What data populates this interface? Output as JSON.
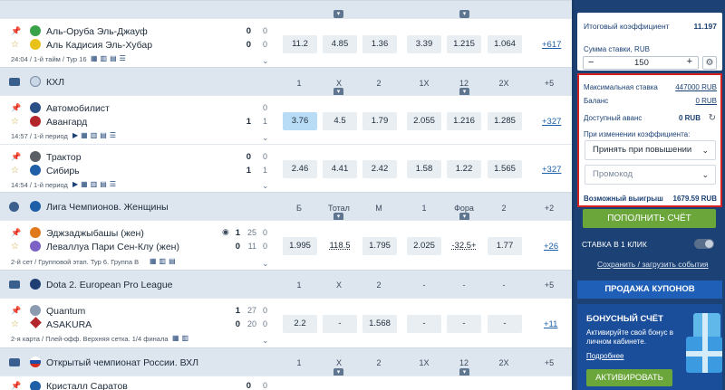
{
  "leagues": [
    {
      "name": "КХЛ",
      "cols": [
        "1",
        "X",
        "2",
        "1X",
        "12",
        "2X",
        "+5"
      ]
    },
    {
      "name": "Лига Чемпионов. Женщины",
      "cols": [
        "Б",
        "Тотал",
        "М",
        "1",
        "Фора",
        "2",
        "+2"
      ]
    },
    {
      "name": "Dota 2. European Pro League",
      "cols": [
        "1",
        "X",
        "2",
        "-",
        "-",
        "-",
        "+5"
      ]
    },
    {
      "name": "Открытый чемпионат России. ВХЛ",
      "cols": [
        "1",
        "X",
        "2",
        "1X",
        "12",
        "2X",
        "+5"
      ]
    }
  ],
  "matches": [
    {
      "team1": "Аль-Оруба Эль-Джауф",
      "team2": "Аль Кадисия Эль-Хубар",
      "s1": "0",
      "s2": "0",
      "p1": "0",
      "p2": "0",
      "info": "24:04 / 1-й тайм / Тур 16",
      "odds": [
        "11.2",
        "4.85",
        "1.36",
        "3.39",
        "1.215",
        "1.064"
      ],
      "more": "+617"
    },
    {
      "team1": "Автомобилист",
      "team2": "Авангард",
      "s1": "",
      "s2": "1",
      "p1": "0",
      "p2": "1",
      "info": "14:57 / 1-й период",
      "odds": [
        "3.76",
        "4.5",
        "1.79",
        "2.055",
        "1.216",
        "1.285"
      ],
      "more": "+327"
    },
    {
      "team1": "Трактор",
      "team2": "Сибирь",
      "s1": "0",
      "s2": "1",
      "p1": "0",
      "p2": "1",
      "info": "14:54 / 1-й период",
      "odds": [
        "2.46",
        "4.41",
        "2.42",
        "1.58",
        "1.22",
        "1.565"
      ],
      "more": "+327"
    },
    {
      "team1": "Эджзаджыбашы (жен)",
      "team2": "Леваллуа Пари Сен-Клу (жен)",
      "s1": "1",
      "s2": "0",
      "p1": "25",
      "p2": "11",
      "p1b": "0",
      "p2b": "0",
      "info": "2-й сет / Групповой этап. Тур 6. Группа B",
      "odds": [
        "1.995",
        "118.5",
        "1.795",
        "2.025",
        "-32.5+",
        "1.77"
      ],
      "more": "+26"
    },
    {
      "team1": "Quantum",
      "team2": "ASAKURA",
      "s1": "1",
      "s2": "0",
      "p1": "27",
      "p2": "20",
      "p1b": "0",
      "p2b": "0",
      "info": "2-я карта / Плей-офф. Верхняя сетка. 1/4 финала",
      "odds": [
        "2.2",
        "-",
        "1.568",
        "-",
        "-",
        "-"
      ],
      "more": "+11"
    },
    {
      "team1": "Кристалл Саратов",
      "s1": "0",
      "p1": "0"
    }
  ],
  "coupon": {
    "total_coef_label": "Итоговый коэффициент",
    "total_coef": "11.197",
    "stake_label": "Сумма ставки, RUB",
    "stake": "150",
    "minus": "−",
    "plus": "+",
    "max_stake_label": "Максимальная ставка",
    "max_stake": "447000 RUB",
    "balance_label": "Баланс",
    "balance": "0 RUB",
    "advance_label": "Доступный аванс",
    "advance": "0 RUB",
    "on_change_label": "При изменении коэффициента:",
    "on_change_value": "Принять при повышении",
    "promo_placeholder": "Промокод",
    "win_label": "Возможный выигрыш",
    "win": "1679.59 RUB",
    "topup": "ПОПОЛНИТЬ СЧЁТ",
    "oneclick": "СТАВКА В 1 КЛИК",
    "save": "Сохранить / загрузить события",
    "sell": "ПРОДАЖА КУПОНОВ",
    "bonus_title": "БОНУСНЫЙ СЧЁТ",
    "bonus_text": "Активируйте свой бонус в личном кабинете.",
    "bonus_more": "Подробнее",
    "activate": "АКТИВИРОВАТЬ"
  }
}
